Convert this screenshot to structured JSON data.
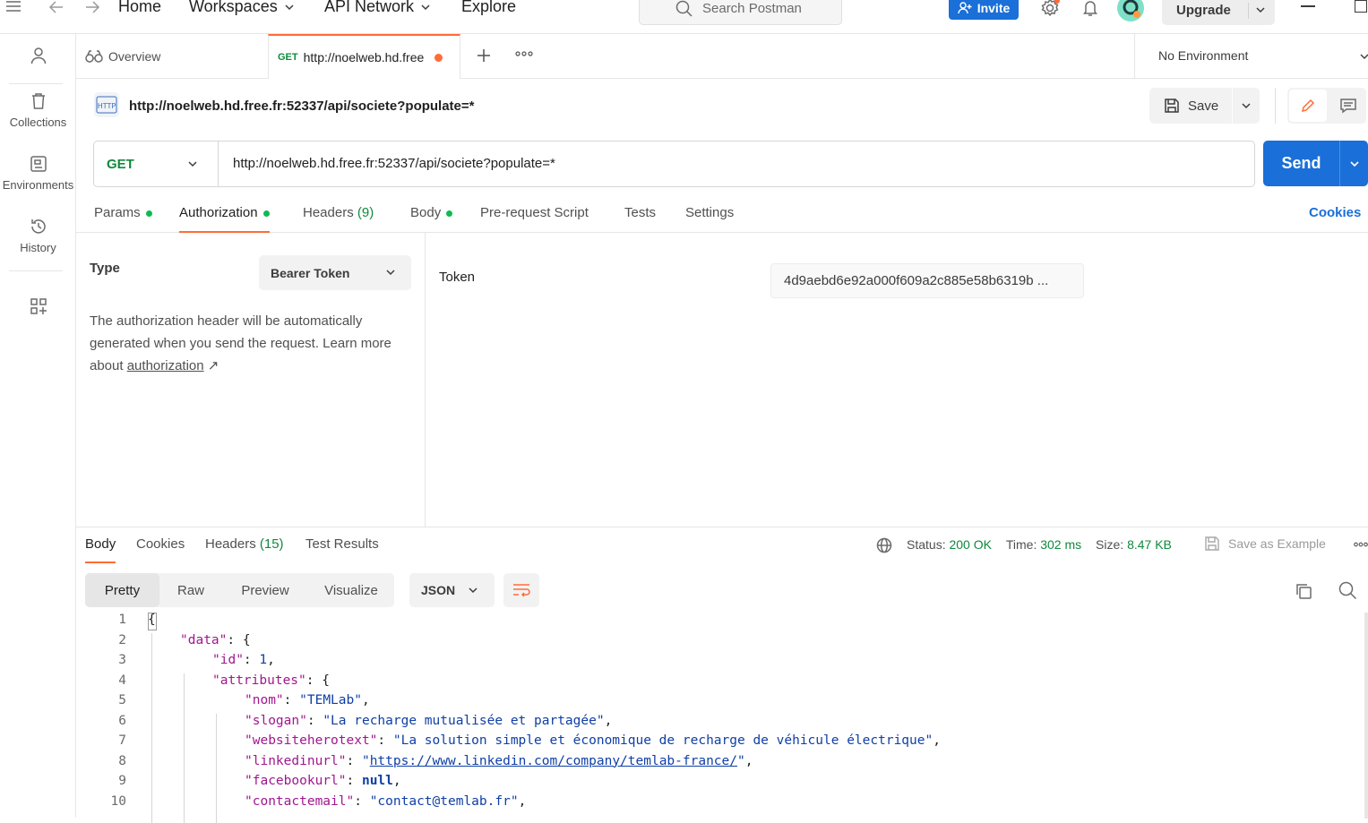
{
  "topbar": {
    "nav": [
      "Home",
      "Workspaces",
      "API Network",
      "Explore"
    ],
    "search_placeholder": "Search Postman",
    "invite_label": "Invite",
    "upgrade_label": "Upgrade"
  },
  "sidebar": {
    "items": [
      {
        "label": ""
      },
      {
        "label": "Collections"
      },
      {
        "label": "Environments"
      },
      {
        "label": "History"
      }
    ]
  },
  "tabs": {
    "overview_label": "Overview",
    "active_method": "GET",
    "active_label": "http://noelweb.hd.free"
  },
  "environment": {
    "selected": "No Environment"
  },
  "request": {
    "title": "http://noelweb.hd.free.fr:52337/api/societe?populate=*",
    "save_label": "Save",
    "method": "GET",
    "url": "http://noelweb.hd.free.fr:52337/api/societe?populate=*",
    "send_label": "Send"
  },
  "request_tabs": {
    "params": "Params",
    "authorization": "Authorization",
    "headers": "Headers",
    "headers_count": "(9)",
    "body": "Body",
    "prerequest": "Pre-request Script",
    "tests": "Tests",
    "settings": "Settings",
    "cookies": "Cookies"
  },
  "auth": {
    "type_label": "Type",
    "type_value": "Bearer Token",
    "help_line1": "The authorization header will be automatically",
    "help_line2": "generated when you send the request. Learn more",
    "help_prefix": "about ",
    "help_link": "authorization",
    "help_arrow": "↗",
    "token_label": "Token",
    "token_value": "4d9aebd6e92a000f609a2c885e58b6319b ..."
  },
  "response": {
    "tabs": {
      "body": "Body",
      "cookies": "Cookies",
      "headers": "Headers",
      "headers_count": "(15)",
      "test_results": "Test Results"
    },
    "status_label": "Status:",
    "status_value": "200 OK",
    "time_label": "Time:",
    "time_value": "302 ms",
    "size_label": "Size:",
    "size_value": "8.47 KB",
    "save_example": "Save as Example",
    "view_modes": [
      "Pretty",
      "Raw",
      "Preview",
      "Visualize"
    ],
    "format": "JSON",
    "colors": {
      "status_ok": "#0f8a3c",
      "accent": "#ff6c37",
      "send": "#1a6fd8"
    }
  },
  "code": {
    "lines": [
      {
        "num": "1",
        "indent": 0,
        "tokens": [
          {
            "t": "p",
            "v": "{"
          }
        ]
      },
      {
        "num": "2",
        "indent": 1,
        "tokens": [
          {
            "t": "k",
            "v": "\"data\""
          },
          {
            "t": "p",
            "v": ": {"
          }
        ]
      },
      {
        "num": "3",
        "indent": 2,
        "tokens": [
          {
            "t": "k",
            "v": "\"id\""
          },
          {
            "t": "p",
            "v": ": "
          },
          {
            "t": "n",
            "v": "1"
          },
          {
            "t": "p",
            "v": ","
          }
        ]
      },
      {
        "num": "4",
        "indent": 2,
        "tokens": [
          {
            "t": "k",
            "v": "\"attributes\""
          },
          {
            "t": "p",
            "v": ": {"
          }
        ]
      },
      {
        "num": "5",
        "indent": 3,
        "tokens": [
          {
            "t": "k",
            "v": "\"nom\""
          },
          {
            "t": "p",
            "v": ": "
          },
          {
            "t": "s",
            "v": "\"TEMLab\""
          },
          {
            "t": "p",
            "v": ","
          }
        ]
      },
      {
        "num": "6",
        "indent": 3,
        "tokens": [
          {
            "t": "k",
            "v": "\"slogan\""
          },
          {
            "t": "p",
            "v": ": "
          },
          {
            "t": "s",
            "v": "\"La recharge mutualisée et partagée\""
          },
          {
            "t": "p",
            "v": ","
          }
        ]
      },
      {
        "num": "7",
        "indent": 3,
        "tokens": [
          {
            "t": "k",
            "v": "\"websiteherotext\""
          },
          {
            "t": "p",
            "v": ": "
          },
          {
            "t": "s",
            "v": "\"La solution simple et économique de recharge de véhicule électrique\""
          },
          {
            "t": "p",
            "v": ","
          }
        ]
      },
      {
        "num": "8",
        "indent": 3,
        "tokens": [
          {
            "t": "k",
            "v": "\"linkedinurl\""
          },
          {
            "t": "p",
            "v": ": "
          },
          {
            "t": "s",
            "v": "\""
          },
          {
            "t": "u",
            "v": "https://www.linkedin.com/company/temlab-france/"
          },
          {
            "t": "s",
            "v": "\""
          },
          {
            "t": "p",
            "v": ","
          }
        ]
      },
      {
        "num": "9",
        "indent": 3,
        "tokens": [
          {
            "t": "k",
            "v": "\"facebookurl\""
          },
          {
            "t": "p",
            "v": ": "
          },
          {
            "t": "kw",
            "v": "null"
          },
          {
            "t": "p",
            "v": ","
          }
        ]
      },
      {
        "num": "10",
        "indent": 3,
        "tokens": [
          {
            "t": "k",
            "v": "\"contactemail\""
          },
          {
            "t": "p",
            "v": ": "
          },
          {
            "t": "s",
            "v": "\"contact@temlab.fr\""
          },
          {
            "t": "p",
            "v": ","
          }
        ]
      }
    ]
  }
}
